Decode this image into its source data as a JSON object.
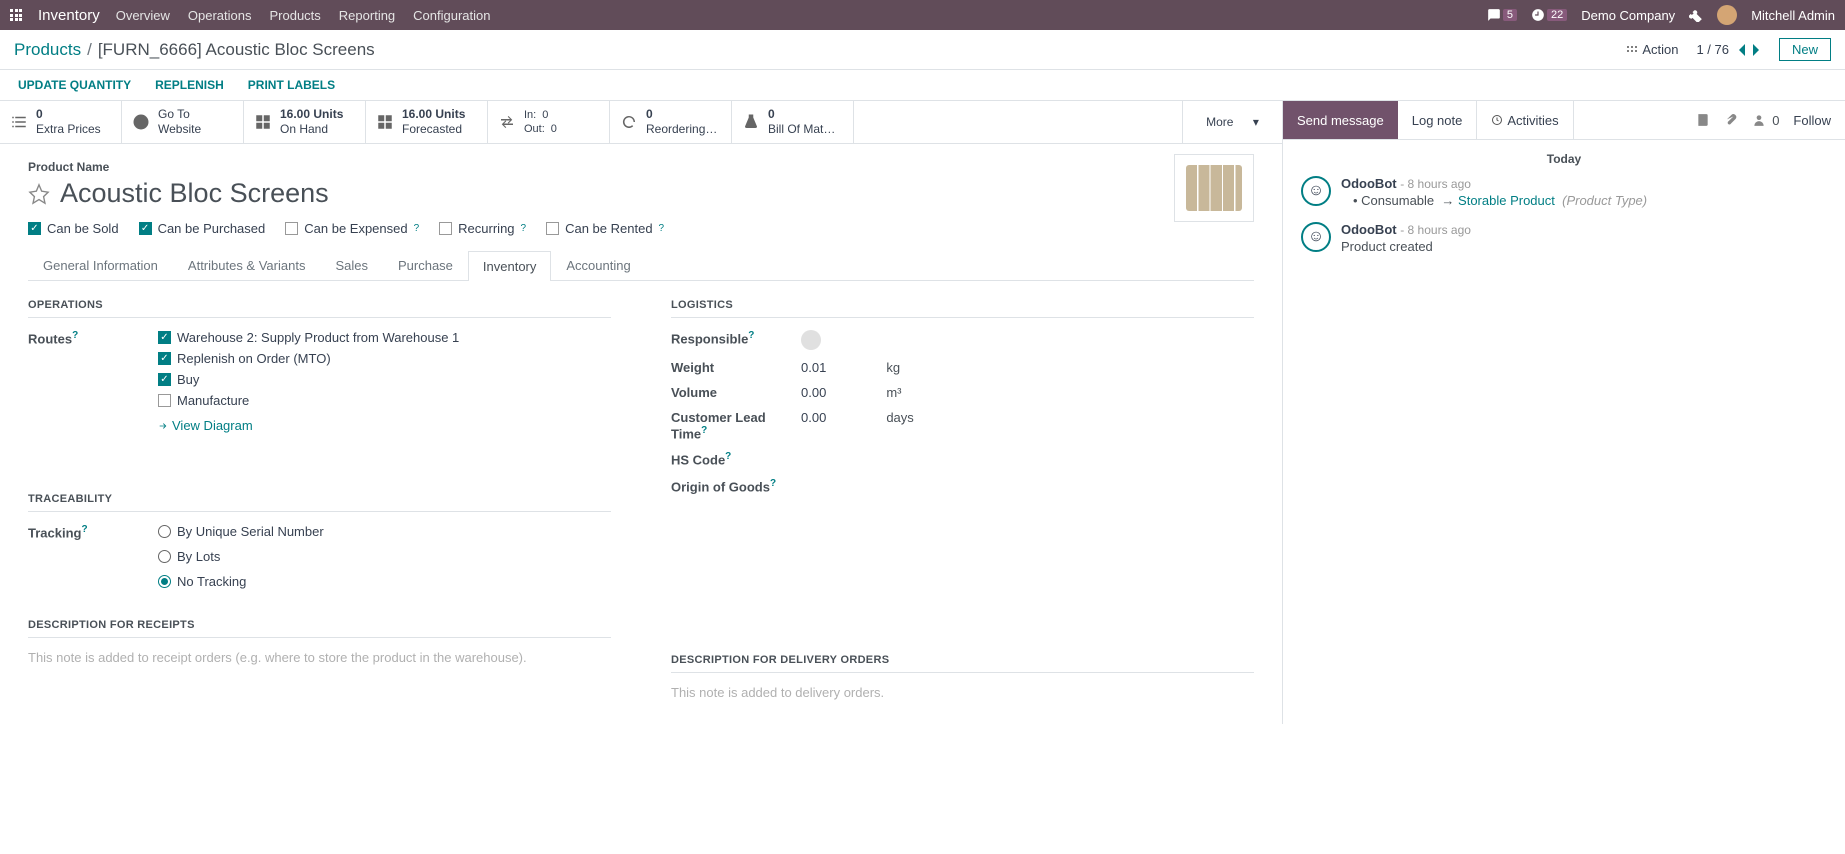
{
  "topbar": {
    "app": "Inventory",
    "menu": [
      "Overview",
      "Operations",
      "Products",
      "Reporting",
      "Configuration"
    ],
    "chat_count": "5",
    "clock_count": "22",
    "company": "Demo Company",
    "user": "Mitchell Admin"
  },
  "header": {
    "bc_parent": "Products",
    "bc_sep": "/",
    "bc_current": "[FURN_6666] Acoustic Bloc Screens",
    "action_label": "Action",
    "pager": "1 / 76",
    "new_label": "New"
  },
  "actionbar": {
    "update": "UPDATE QUANTITY",
    "replenish": "REPLENISH",
    "print": "PRINT LABELS"
  },
  "stats": {
    "extra_prices": {
      "num": "0",
      "label": "Extra Prices"
    },
    "website": {
      "top": "Go To",
      "label": "Website"
    },
    "onhand": {
      "num": "16.00 Units",
      "label": "On Hand"
    },
    "forecast": {
      "num": "16.00 Units",
      "label": "Forecasted"
    },
    "in": {
      "label": "In:",
      "val": "0"
    },
    "out": {
      "label": "Out:",
      "val": "0"
    },
    "reorder": {
      "num": "0",
      "label": "Reordering…"
    },
    "bom": {
      "num": "0",
      "label": "Bill Of Mat…"
    },
    "more": "More"
  },
  "product": {
    "name_label": "Product Name",
    "name": "Acoustic Bloc Screens",
    "checks": {
      "sold": "Can be Sold",
      "purchased": "Can be Purchased",
      "expensed": "Can be Expensed",
      "recurring": "Recurring",
      "rented": "Can be Rented"
    },
    "tabs": [
      "General Information",
      "Attributes & Variants",
      "Sales",
      "Purchase",
      "Inventory",
      "Accounting"
    ]
  },
  "form": {
    "operations_title": "OPERATIONS",
    "routes_label": "Routes",
    "routes": {
      "wh2": "Warehouse 2: Supply Product from Warehouse 1",
      "mto": "Replenish on Order (MTO)",
      "buy": "Buy",
      "mfg": "Manufacture"
    },
    "view_diagram": "View Diagram",
    "logistics_title": "LOGISTICS",
    "responsible": "Responsible",
    "weight": {
      "label": "Weight",
      "val": "0.01",
      "unit": "kg"
    },
    "volume": {
      "label": "Volume",
      "val": "0.00",
      "unit": "m³"
    },
    "lead": {
      "label": "Customer Lead Time",
      "val": "0.00",
      "unit": "days"
    },
    "hscode": "HS Code",
    "origin": "Origin of Goods",
    "traceability_title": "TRACEABILITY",
    "tracking_label": "Tracking",
    "tracking": {
      "serial": "By Unique Serial Number",
      "lots": "By Lots",
      "none": "No Tracking"
    },
    "desc_receipts_title": "DESCRIPTION FOR RECEIPTS",
    "desc_receipts_ph": "This note is added to receipt orders (e.g. where to store the product in the warehouse).",
    "desc_delivery_title": "DESCRIPTION FOR DELIVERY ORDERS",
    "desc_delivery_ph": "This note is added to delivery orders."
  },
  "chatter": {
    "send": "Send message",
    "log": "Log note",
    "activities": "Activities",
    "follower_count": "0",
    "follow": "Follow",
    "today": "Today",
    "msgs": [
      {
        "name": "OdooBot",
        "time": "- 8 hours ago",
        "bullet_label": "Consumable",
        "arrow": "→",
        "link": "Storable Product",
        "muted": "(Product Type)"
      },
      {
        "name": "OdooBot",
        "time": "- 8 hours ago",
        "text": "Product created"
      }
    ]
  }
}
